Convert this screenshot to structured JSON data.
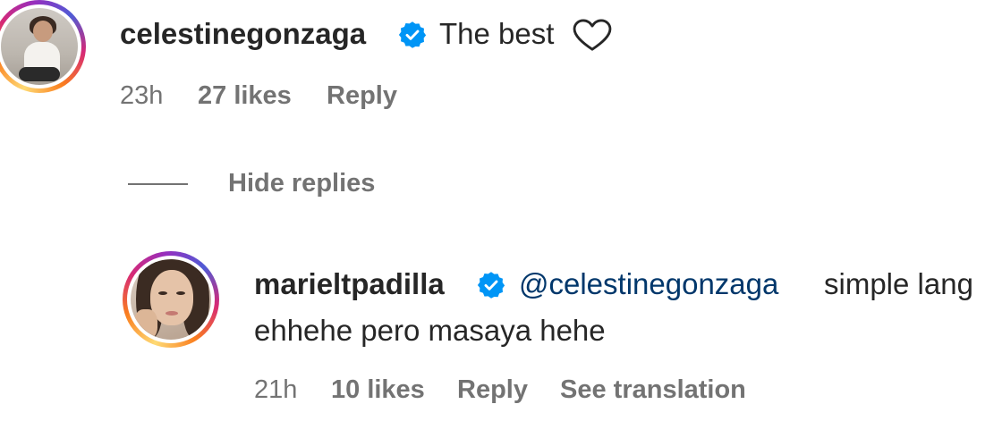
{
  "comments": [
    {
      "username": "celestinegonzaga",
      "verified": true,
      "text": "The best",
      "time": "23h",
      "likes": "27 likes",
      "reply_label": "Reply"
    },
    {
      "username": "marieltpadilla",
      "verified": true,
      "mention": "@celestinegonzaga",
      "text_line1": "simple lang",
      "text_line2": "ehhehe pero masaya hehe",
      "time": "21h",
      "likes": "10 likes",
      "reply_label": "Reply",
      "translation_label": "See translation"
    }
  ],
  "replies_toggle": {
    "label": "Hide replies"
  },
  "icons": {
    "heart": "heart-outline-icon",
    "verified": "verified-badge-icon"
  },
  "colors": {
    "text_primary": "#262626",
    "text_secondary": "#737373",
    "verified_blue": "#0095f6",
    "mention": "#00376b"
  }
}
